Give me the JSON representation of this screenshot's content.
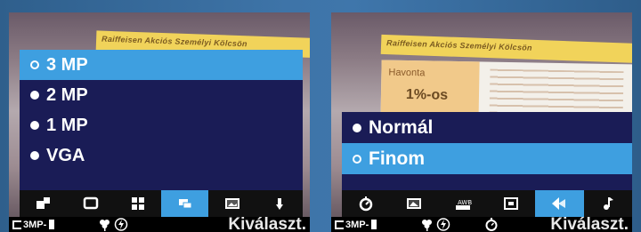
{
  "left_screen": {
    "banner_text": "Raiffeisen Akciós Személyi Kölcsön",
    "menu_items": [
      {
        "label": "3 MP",
        "selected": true
      },
      {
        "label": "2 MP",
        "selected": false
      },
      {
        "label": "1 MP",
        "selected": false
      },
      {
        "label": "VGA",
        "selected": false
      }
    ],
    "toolbar_icons": [
      "multishot-icon",
      "frame-icon",
      "grid-icon",
      "resolution-icon",
      "image-quality-icon",
      "light-icon"
    ],
    "active_toolbar_index": 3,
    "statusbar": {
      "mp_label": "3MP-",
      "select_label": "Kiválaszt."
    }
  },
  "right_screen": {
    "banner_text": "Raiffeisen Akciós Személyi Kölcsön",
    "doc_label": "Havonta",
    "doc_value": "1%-os",
    "menu_items": [
      {
        "label": "Normál",
        "selected": false
      },
      {
        "label": "Finom",
        "selected": true
      }
    ],
    "toolbar_icons": [
      "self-timer-icon",
      "image-quality-icon",
      "white-balance-icon",
      "frame-icon",
      "night-mode-icon",
      "sound-icon"
    ],
    "active_toolbar_index": 4,
    "statusbar": {
      "mp_label": "3MP-",
      "select_label": "Kiválaszt."
    }
  },
  "colors": {
    "menu_background": "#1a1c56",
    "selected_highlight": "#3e9fe0",
    "outer_background": "#3e74a8"
  }
}
